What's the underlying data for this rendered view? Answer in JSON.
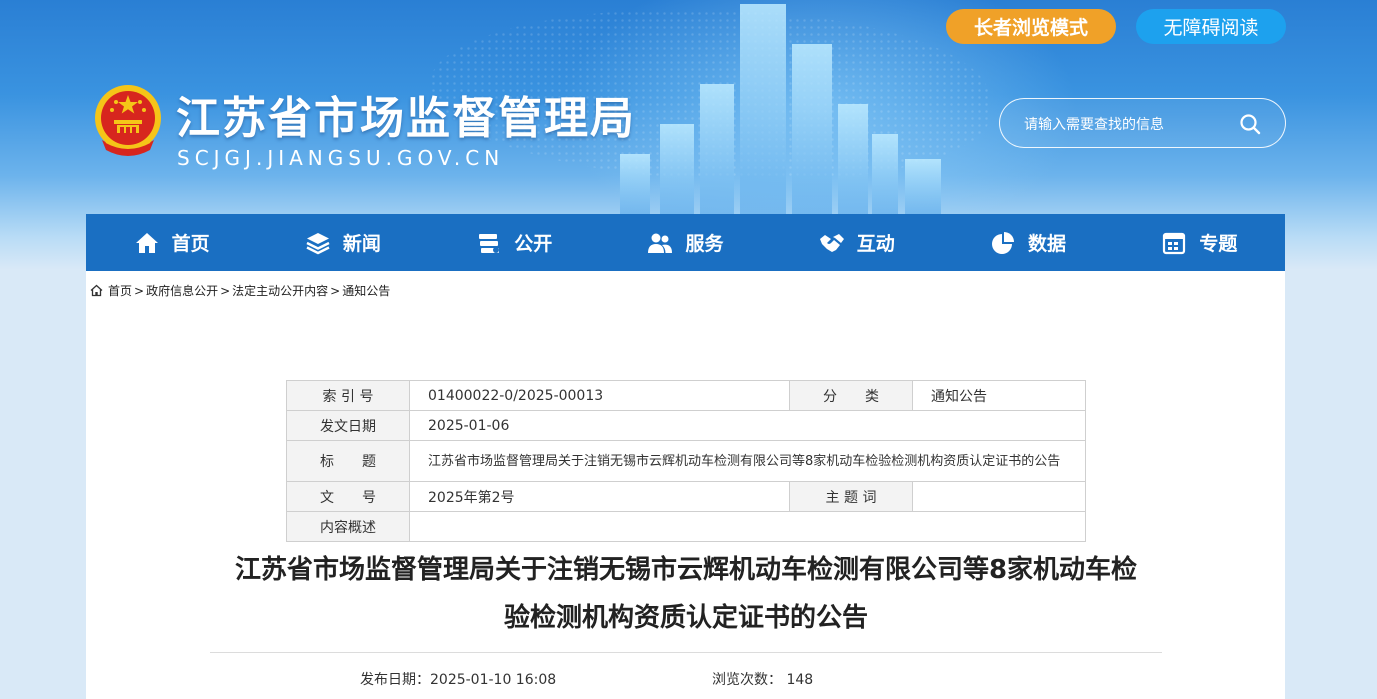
{
  "header": {
    "site_title": "江苏省市场监督管理局",
    "site_domain": "SCJGJ.JIANGSU.GOV.CN",
    "elder_mode_label": "长者浏览模式",
    "accessible_label": "无障碍阅读",
    "search_placeholder": "请输入需要查找的信息"
  },
  "nav": {
    "items": [
      {
        "label": "首页",
        "icon": "home-icon"
      },
      {
        "label": "新闻",
        "icon": "layers-icon"
      },
      {
        "label": "公开",
        "icon": "stack-icon"
      },
      {
        "label": "服务",
        "icon": "users-icon"
      },
      {
        "label": "互动",
        "icon": "handshake-icon"
      },
      {
        "label": "数据",
        "icon": "pie-chart-icon"
      },
      {
        "label": "专题",
        "icon": "calendar-icon"
      }
    ]
  },
  "breadcrumb": {
    "items": [
      "首页",
      "政府信息公开",
      "法定主动公开内容",
      "通知公告"
    ],
    "sep": ">"
  },
  "meta": {
    "index_label": "索 引 号",
    "index_value": "01400022-0/2025-00013",
    "category_label": "分　　类",
    "category_value": "通知公告",
    "date_label": "发文日期",
    "date_value": "2025-01-06",
    "title_label": "标　　题",
    "title_value": "江苏省市场监督管理局关于注销无锡市云辉机动车检测有限公司等8家机动车检验检测机构资质认定证书的公告",
    "doc_no_label": "文　　号",
    "doc_no_value": "2025年第2号",
    "subject_label": "主 题 词",
    "subject_value": "",
    "summary_label": "内容概述",
    "summary_value": ""
  },
  "article": {
    "title_line1": "江苏省市场监督管理局关于注销无锡市云辉机动车检测有限公司等8家机动车检",
    "title_line2": "验检测机构资质认定证书的公告",
    "publish_label": "发布日期：",
    "publish_value": "2025-01-10 16:08",
    "views_label": "浏览次数：",
    "views_value": "148"
  },
  "colors": {
    "nav_bg": "#1a6fc2",
    "elder_btn": "#f0a128",
    "access_btn": "#1da1ee",
    "emblem_red": "#d7261e",
    "emblem_gold": "#f5c518"
  }
}
